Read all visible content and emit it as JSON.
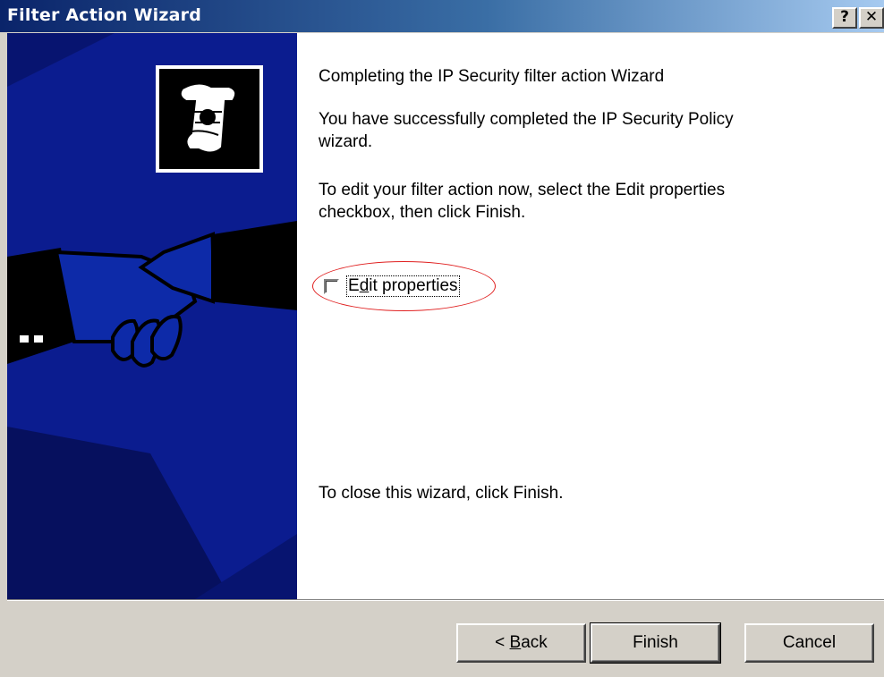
{
  "window": {
    "title": "Filter Action Wizard",
    "help_glyph": "?",
    "close_glyph": "✕"
  },
  "content": {
    "heading": "Completing the IP Security filter action Wizard",
    "paragraph1": "You have successfully completed the IP Security Policy wizard.",
    "paragraph2": "To edit your filter action now, select the Edit properties checkbox, then click Finish.",
    "checkbox": {
      "label_pre": "E",
      "label_underlined": "d",
      "label_post": "it properties",
      "checked": false
    },
    "paragraph3": "To close this wizard, click Finish."
  },
  "buttons": {
    "back_pre": "< ",
    "back_underlined": "B",
    "back_post": "ack",
    "finish": "Finish",
    "cancel": "Cancel"
  },
  "colors": {
    "side_panel": "#0b1c8f",
    "annotation": "#e02020",
    "titlebar_start": "#0a246a"
  },
  "icons": [
    "scroll-certificate-icon",
    "handshake-illustration",
    "help-icon",
    "close-icon"
  ]
}
